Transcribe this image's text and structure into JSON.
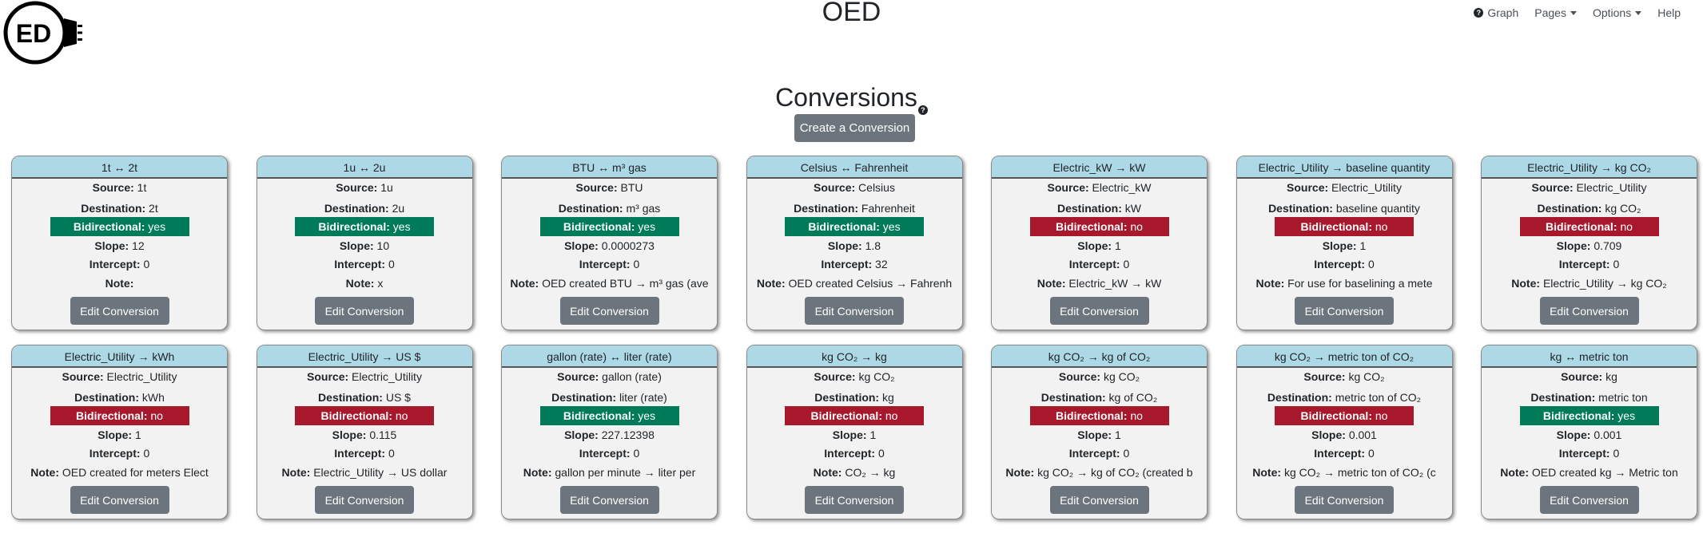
{
  "app": {
    "title": "OED",
    "logo_text": "ED"
  },
  "nav": {
    "graph": "Graph",
    "pages": "Pages",
    "options": "Options",
    "help": "Help"
  },
  "page": {
    "title": "Conversions",
    "help_glyph": "?",
    "create_button": "Create a Conversion"
  },
  "labels": {
    "source": "Source:",
    "destination": "Destination:",
    "bidirectional": "Bidirectional:",
    "slope": "Slope:",
    "intercept": "Intercept:",
    "note": "Note:",
    "edit_button": "Edit Conversion"
  },
  "colors": {
    "header_bg": "#add8e6",
    "yes": "#007b59",
    "no": "#a8182d",
    "button": "#6c757d"
  },
  "conversions": [
    {
      "title": "1t ↔ 2t",
      "source": "1t",
      "destination": "2t",
      "bidirectional": "yes",
      "slope": "12",
      "intercept": "0",
      "note": ""
    },
    {
      "title": "1u ↔ 2u",
      "source": "1u",
      "destination": "2u",
      "bidirectional": "yes",
      "slope": "10",
      "intercept": "0",
      "note": "x"
    },
    {
      "title": "BTU ↔ m³ gas",
      "source": "BTU",
      "destination": "m³ gas",
      "bidirectional": "yes",
      "slope": "0.0000273",
      "intercept": "0",
      "note": "OED created BTU → m³ gas (ave"
    },
    {
      "title": "Celsius ↔ Fahrenheit",
      "source": "Celsius",
      "destination": "Fahrenheit",
      "bidirectional": "yes",
      "slope": "1.8",
      "intercept": "32",
      "note": "OED created Celsius → Fahrenh"
    },
    {
      "title": "Electric_kW → kW",
      "source": "Electric_kW",
      "destination": "kW",
      "bidirectional": "no",
      "slope": "1",
      "intercept": "0",
      "note": "Electric_kW → kW"
    },
    {
      "title": "Electric_Utility → baseline quantity",
      "source": "Electric_Utility",
      "destination": "baseline quantity",
      "bidirectional": "no",
      "slope": "1",
      "intercept": "0",
      "note": "For use for baselining a mete"
    },
    {
      "title": "Electric_Utility → kg CO₂",
      "source": "Electric_Utility",
      "destination": "kg CO₂",
      "bidirectional": "no",
      "slope": "0.709",
      "intercept": "0",
      "note": "Electric_Utility → kg CO₂"
    },
    {
      "title": "Electric_Utility → kWh",
      "source": "Electric_Utility",
      "destination": "kWh",
      "bidirectional": "no",
      "slope": "1",
      "intercept": "0",
      "note": "OED created for meters Elect"
    },
    {
      "title": "Electric_Utility → US $",
      "source": "Electric_Utility",
      "destination": "US $",
      "bidirectional": "no",
      "slope": "0.115",
      "intercept": "0",
      "note": "Electric_Utility → US dollar"
    },
    {
      "title": "gallon (rate) ↔ liter (rate)",
      "source": "gallon (rate)",
      "destination": "liter (rate)",
      "bidirectional": "yes",
      "slope": "227.12398",
      "intercept": "0",
      "note": "gallon per minute → liter per"
    },
    {
      "title": "kg CO₂ → kg",
      "source": "kg CO₂",
      "destination": "kg",
      "bidirectional": "no",
      "slope": "1",
      "intercept": "0",
      "note": "CO₂ → kg"
    },
    {
      "title": "kg CO₂ → kg of CO₂",
      "source": "kg CO₂",
      "destination": "kg of CO₂",
      "bidirectional": "no",
      "slope": "1",
      "intercept": "0",
      "note": "kg CO₂ → kg of CO₂ (created b"
    },
    {
      "title": "kg CO₂ → metric ton of CO₂",
      "source": "kg CO₂",
      "destination": "metric ton of CO₂",
      "bidirectional": "no",
      "slope": "0.001",
      "intercept": "0",
      "note": "kg CO₂ → metric ton of CO₂ (c"
    },
    {
      "title": "kg ↔ metric ton",
      "source": "kg",
      "destination": "metric ton",
      "bidirectional": "yes",
      "slope": "0.001",
      "intercept": "0",
      "note": "OED created kg → Metric ton"
    }
  ]
}
